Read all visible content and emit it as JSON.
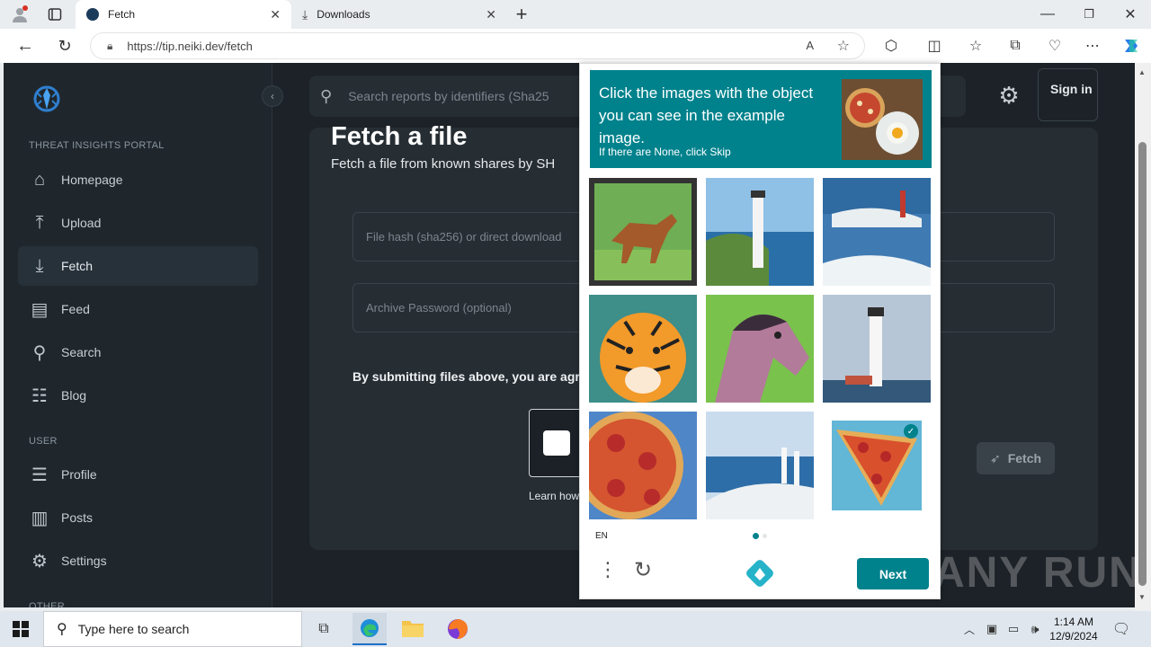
{
  "browser": {
    "tabs": [
      {
        "label": "Fetch"
      },
      {
        "label": "Downloads"
      }
    ],
    "url": "https://tip.neiki.dev/fetch"
  },
  "sidebar": {
    "section_main": "THREAT INSIGHTS PORTAL",
    "items": [
      {
        "label": "Homepage",
        "icon": "home-icon"
      },
      {
        "label": "Upload",
        "icon": "upload-icon"
      },
      {
        "label": "Fetch",
        "icon": "download-icon"
      },
      {
        "label": "Feed",
        "icon": "feed-icon"
      },
      {
        "label": "Search",
        "icon": "search-icon"
      },
      {
        "label": "Blog",
        "icon": "blog-icon"
      }
    ],
    "section_user": "USER",
    "user_items": [
      {
        "label": "Profile",
        "icon": "profile-icon"
      },
      {
        "label": "Posts",
        "icon": "posts-icon"
      },
      {
        "label": "Settings",
        "icon": "gear-icon"
      }
    ],
    "section_other": "OTHER"
  },
  "header": {
    "search_placeholder": "Search reports by identifiers (Sha25",
    "signin_label": "Sign in"
  },
  "main": {
    "title": "Fetch a file",
    "subtitle": "Fetch a file from known shares by SH",
    "hash_placeholder": "File hash (sha256) or direct download",
    "password_placeholder": "Archive Password (optional)",
    "terms_text": "By submitting files above, you are agre",
    "learn_text": "Learn how",
    "fetch_button": "Fetch"
  },
  "captcha": {
    "prompt": "Click the images with the object you can see in the example image.",
    "hint": "If there are None, click Skip",
    "language": "EN",
    "next_label": "Next",
    "tiles": [
      "horse-painting",
      "lighthouse-cliff",
      "lighthouse-snow",
      "tiger",
      "horse-head",
      "lighthouse-tall",
      "pizza",
      "lighthouses-coast",
      "pizza-slice-selected"
    ],
    "selected": [
      8
    ]
  },
  "watermark": "ANY RUN",
  "taskbar": {
    "search_placeholder": "Type here to search",
    "time": "1:14 AM",
    "date": "12/9/2024"
  }
}
